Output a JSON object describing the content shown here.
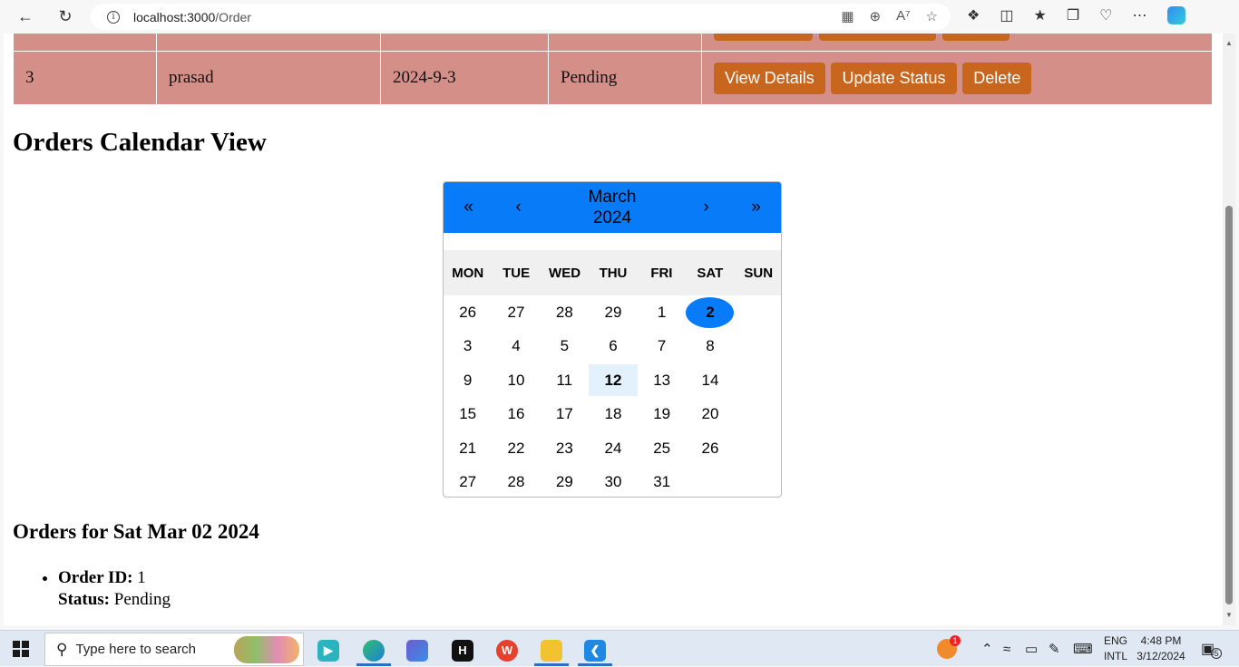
{
  "browser": {
    "url_host": "localhost:3000",
    "url_path": "/Order"
  },
  "table": {
    "row": {
      "id": "3",
      "name": "prasad",
      "date": "2024-9-3",
      "status": "Pending",
      "actions": [
        "View Details",
        "Update Status",
        "Delete"
      ]
    }
  },
  "calendar_section": {
    "title": "Orders Calendar View",
    "month": "March",
    "year": "2024",
    "nav": {
      "prev_year": "«",
      "prev_month": "‹",
      "next_month": "›",
      "next_year": "»"
    },
    "weekdays": [
      "MON",
      "TUE",
      "WED",
      "THU",
      "FRI",
      "SAT",
      "SUN"
    ],
    "days": [
      "26",
      "27",
      "28",
      "29",
      "1",
      "2",
      "",
      "3",
      "4",
      "5",
      "6",
      "7",
      "8",
      "",
      "9",
      "10",
      "11",
      "12",
      "13",
      "14",
      "",
      "15",
      "16",
      "17",
      "18",
      "19",
      "20",
      "",
      "21",
      "22",
      "23",
      "24",
      "25",
      "26",
      "",
      "27",
      "28",
      "29",
      "30",
      "31",
      "",
      ""
    ],
    "selected_day": "2",
    "today": "12"
  },
  "orders_for": {
    "heading": "Orders for Sat Mar 02 2024",
    "items": [
      {
        "id_label": "Order ID:",
        "id": "1",
        "status_label": "Status:",
        "status": "Pending"
      }
    ]
  },
  "taskbar": {
    "search_placeholder": "Type here to search",
    "lang_top": "ENG",
    "lang_bottom": "INTL",
    "time": "4:48 PM",
    "date": "3/12/2024",
    "notification_count": "5",
    "badge_count": "1"
  },
  "colors": {
    "accent": "#087cf8",
    "button": "#c8661e",
    "row_bg": "#d49088"
  }
}
